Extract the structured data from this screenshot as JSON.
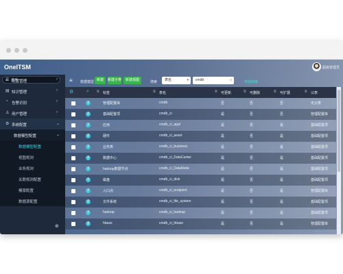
{
  "app": {
    "title": "OneITSM",
    "user": "超级管理员"
  },
  "sidebar": {
    "search_placeholder": "搜索",
    "items": [
      {
        "label": "配置管理",
        "icon": "list-icon"
      },
      {
        "label": "知识管理",
        "icon": "book-icon"
      },
      {
        "label": "告警识别",
        "icon": "bell-icon"
      },
      {
        "label": "用户管理",
        "icon": "user-icon"
      },
      {
        "label": "系统配置",
        "icon": "gear-icon"
      }
    ],
    "sub": {
      "label": "数据模型配置"
    },
    "children": [
      {
        "label": "数据模型配置"
      },
      {
        "label": "视图规则"
      },
      {
        "label": "业务规则"
      },
      {
        "label": "关联规则配置"
      },
      {
        "label": "模版配置"
      },
      {
        "label": "数据源配置"
      }
    ]
  },
  "toolbar": {
    "title": "数据模型",
    "btn_add": "新建",
    "btn_addchild": "新建子类",
    "btn_edit": "新建视图",
    "search_label": "搜索",
    "field_select": "表名",
    "field_value": "cmdb",
    "advanced_link": "高级搜索"
  },
  "table": {
    "columns": [
      "标签",
      "表名",
      "可更新",
      "可删除",
      "可扩展",
      "父表"
    ],
    "rows": [
      {
        "label": "管理配置库",
        "name": "cmdb",
        "update": "否",
        "delete": "否",
        "extend": "否",
        "parent": "无父表"
      },
      {
        "label": "基础配置项",
        "name": "cmdb_ci",
        "update": "是",
        "delete": "否",
        "extend": "否",
        "parent": "管理配置库"
      },
      {
        "label": "应用",
        "name": "cmdb_ci_appl",
        "update": "是",
        "delete": "否",
        "extend": "是",
        "parent": "基础配置项"
      },
      {
        "label": "硬件",
        "name": "cmdb_ci_asset",
        "update": "是",
        "delete": "否",
        "extend": "是",
        "parent": "基础配置项"
      },
      {
        "label": "业务类",
        "name": "cmdb_ci_business",
        "update": "是",
        "delete": "否",
        "extend": "是",
        "parent": "基础配置项"
      },
      {
        "label": "数据中心",
        "name": "cmdb_ci_DataCenter",
        "update": "是",
        "delete": "否",
        "extend": "是",
        "parent": "基础配置项"
      },
      {
        "label": "hadoop数据节点",
        "name": "cmdb_ci_DataNode",
        "update": "是",
        "delete": "否",
        "extend": "是",
        "parent": "基础配置项"
      },
      {
        "label": "磁盘",
        "name": "cmdb_ci_disk",
        "update": "是",
        "delete": "否",
        "extend": "是",
        "parent": "基础配置项"
      },
      {
        "label": "入口点",
        "name": "cmdb_ci_endpoint",
        "update": "是",
        "delete": "否",
        "extend": "是",
        "parent": "管理配置库"
      },
      {
        "label": "文件系统",
        "name": "cmdb_ci_file_system",
        "update": "是",
        "delete": "否",
        "extend": "是",
        "parent": "基础配置项"
      },
      {
        "label": "hadoop",
        "name": "cmdb_ci_hadoop",
        "update": "是",
        "delete": "否",
        "extend": "是",
        "parent": "基础配置项"
      },
      {
        "label": "hbase",
        "name": "cmdb_ci_hbase",
        "update": "是",
        "delete": "否",
        "extend": "是",
        "parent": "管理配置库"
      }
    ]
  },
  "colors": {
    "accent": "#36b54a",
    "link": "#37e0d6",
    "info": "#3ec7e6",
    "sidebar_bg": "#1e2a3b"
  }
}
